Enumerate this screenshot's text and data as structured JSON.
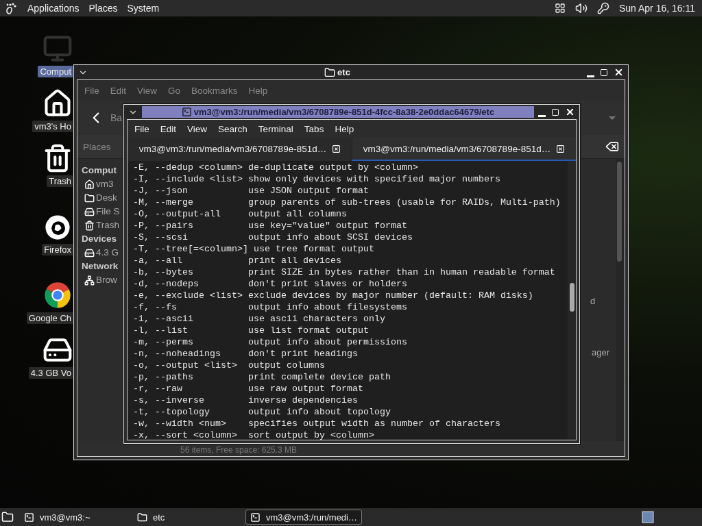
{
  "top_panel": {
    "menus": [
      "Applications",
      "Places",
      "System"
    ],
    "clock": "Sun Apr 16, 16:11"
  },
  "desktop_icons": [
    {
      "label": "Comput",
      "kind": "computer",
      "selected": true
    },
    {
      "label": "vm3's Ho",
      "kind": "home",
      "selected": false
    },
    {
      "label": "Trash",
      "kind": "trash",
      "selected": false
    },
    {
      "label": "Firefox",
      "kind": "firefox",
      "selected": false
    },
    {
      "label": "Google Ch",
      "kind": "chrome",
      "selected": false
    },
    {
      "label": "4.3 GB Vo",
      "kind": "disk",
      "selected": false
    }
  ],
  "file_manager": {
    "title": "etc",
    "menu": [
      "File",
      "Edit",
      "View",
      "Go",
      "Bookmarks",
      "Help"
    ],
    "back_label": "Ba",
    "places_label": "Places",
    "sidebar": [
      {
        "heading": "Comput",
        "items": [
          {
            "label": "vm3",
            "kind": "home"
          },
          {
            "label": "Desk",
            "kind": "folder"
          },
          {
            "label": "File S",
            "kind": "disk"
          },
          {
            "label": "Trash",
            "kind": "trash"
          }
        ]
      },
      {
        "heading": "Devices",
        "items": [
          {
            "label": "4.3 G",
            "kind": "disk"
          }
        ]
      },
      {
        "heading": "Network",
        "items": [
          {
            "label": "Brow",
            "kind": "network"
          }
        ]
      }
    ],
    "content_fragments": [
      "d",
      "ager"
    ],
    "status": "56 items, Free space: 625.3 MB"
  },
  "terminal": {
    "title": "vm3@vm3:/run/media/vm3/6708789e-851d-4fcc-8a38-2e0ddac64679/etc",
    "menu": [
      "File",
      "Edit",
      "View",
      "Search",
      "Terminal",
      "Tabs",
      "Help"
    ],
    "tabs": [
      {
        "label": "vm3@vm3:/run/media/vm3/6708789e-851d…",
        "selected": false
      },
      {
        "label": "vm3@vm3:/run/media/vm3/6708789e-851d…",
        "selected": true
      }
    ],
    "lines": [
      "-E, --dedup <column> de-duplicate output by <column>",
      "-I, --include <list> show only devices with specified major numbers",
      "-J, --json           use JSON output format",
      "-M, --merge          group parents of sub-trees (usable for RAIDs, Multi-path)",
      "-O, --output-all     output all columns",
      "-P, --pairs          use key=\"value\" output format",
      "-S, --scsi           output info about SCSI devices",
      "-T, --tree[=<column>] use tree format output",
      "-a, --all            print all devices",
      "-b, --bytes          print SIZE in bytes rather than in human readable format",
      "-d, --nodeps         don't print slaves or holders",
      "-e, --exclude <list> exclude devices by major number (default: RAM disks)",
      "-f, --fs             output info about filesystems",
      "-i, --ascii          use ascii characters only",
      "-l, --list           use list format output",
      "-m, --perms          output info about permissions",
      "-n, --noheadings     don't print headings",
      "-o, --output <list>  output columns",
      "-p, --paths          print complete device path",
      "-r, --raw            use raw output format",
      "-s, --inverse        inverse dependencies",
      "-t, --topology       output info about topology",
      "-w, --width <num>    specifies output width as number of characters",
      "-x, --sort <column>  sort output by <column>"
    ]
  },
  "taskbar": {
    "items": [
      {
        "label": "vm3@vm3:~",
        "kind": "terminal",
        "selected": false
      },
      {
        "label": "etc",
        "kind": "folder",
        "selected": false
      },
      {
        "label": "vm3@vm3:/run/medi…",
        "kind": "terminal",
        "selected": true
      }
    ]
  }
}
